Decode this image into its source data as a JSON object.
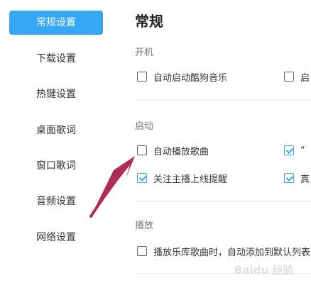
{
  "sidebar": {
    "items": [
      {
        "label": "常规设置",
        "active": true
      },
      {
        "label": "下载设置"
      },
      {
        "label": "热键设置"
      },
      {
        "label": "桌面歌词"
      },
      {
        "label": "窗口歌词"
      },
      {
        "label": "音频设置"
      },
      {
        "label": "网络设置"
      }
    ]
  },
  "main": {
    "title": "常规",
    "sections": [
      {
        "title": "开机",
        "options": [
          {
            "label": "自动启动酷狗音乐",
            "checked": false
          },
          {
            "label": "启",
            "checked": false
          }
        ]
      },
      {
        "title": "启动",
        "options": [
          {
            "label": "自动播放歌曲",
            "checked": false
          },
          {
            "label": "“",
            "checked": true
          },
          {
            "label": "关注主播上线提醒",
            "checked": true
          },
          {
            "label": "真",
            "checked": true
          }
        ]
      },
      {
        "title": "播放",
        "options": [
          {
            "label": "播放乐库歌曲时，自动添加到默认列表",
            "checked": false
          }
        ]
      }
    ]
  },
  "colors": {
    "accent": "#35a7f5",
    "arrow": "#b02a5a"
  },
  "watermark": "Baidu 经验"
}
